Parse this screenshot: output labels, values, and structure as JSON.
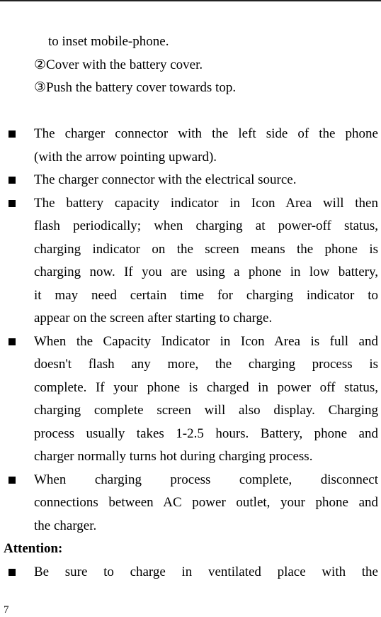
{
  "steps": [
    {
      "text": "to inset mobile-phone.",
      "indent": true
    },
    {
      "text": "②Cover with the battery cover."
    },
    {
      "text": "③Push the battery cover towards top."
    }
  ],
  "bullets": [
    {
      "lines": [
        "The charger connector with the left side of the phone",
        "(with the arrow pointing upward)."
      ]
    },
    {
      "lines": [
        "The charger connector with the electrical source."
      ]
    },
    {
      "lines": [
        "The battery capacity indicator in Icon Area will then",
        "flash periodically; when charging at power-off status,",
        "charging indicator on the screen means the phone is",
        "charging now. If you are using a phone in low battery,",
        "it may need certain time for charging indicator to",
        "appear on the screen after starting to charge."
      ]
    },
    {
      "lines": [
        "When the Capacity Indicator in Icon Area is full and",
        "doesn't flash any more, the charging process is",
        "complete. If your phone is charged in power off status,",
        "charging complete screen will also display.   Charging",
        "process usually takes 1-2.5 hours. Battery, phone and",
        "charger normally turns hot during charging process."
      ]
    },
    {
      "lines": [
        "When charging process complete, disconnect",
        "connections between AC power outlet, your phone and",
        "the charger."
      ]
    }
  ],
  "attention": {
    "heading": "Attention:",
    "bullets": [
      {
        "lines": [
          "Be sure to charge in ventilated place with the"
        ],
        "continues": true
      }
    ]
  },
  "page_number": "7"
}
